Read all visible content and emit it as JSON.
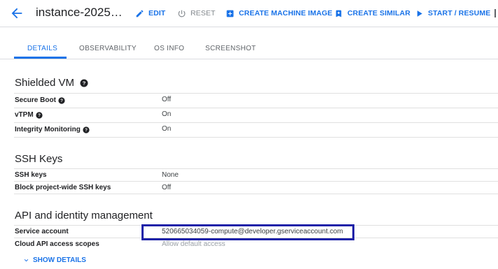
{
  "header": {
    "title": "instance-2025…",
    "actions": {
      "edit": "EDIT",
      "reset": "RESET",
      "create_machine_image": "CREATE MACHINE IMAGE",
      "create_similar": "CREATE SIMILAR",
      "start_resume": "START / RESUME"
    }
  },
  "tabs": [
    "DETAILS",
    "OBSERVABILITY",
    "OS INFO",
    "SCREENSHOT"
  ],
  "active_tab": "DETAILS",
  "shielded_vm": {
    "title": "Shielded VM",
    "rows": [
      {
        "label": "Secure Boot",
        "value": "Off"
      },
      {
        "label": "vTPM",
        "value": "On"
      },
      {
        "label": "Integrity Monitoring",
        "value": "On"
      }
    ]
  },
  "ssh_keys": {
    "title": "SSH Keys",
    "rows": [
      {
        "label": "SSH keys",
        "value": "None"
      },
      {
        "label": "Block project-wide SSH keys",
        "value": "Off"
      }
    ]
  },
  "api_identity": {
    "title": "API and identity management",
    "rows": [
      {
        "label": "Service account",
        "value": "520665034059-compute@developer.gserviceaccount.com"
      },
      {
        "label": "Cloud API access scopes",
        "value": "Allow default access"
      }
    ]
  },
  "show_details": "SHOW DETAILS",
  "colors": {
    "accent": "#1a73e8",
    "highlight_border": "#1e22a8"
  }
}
